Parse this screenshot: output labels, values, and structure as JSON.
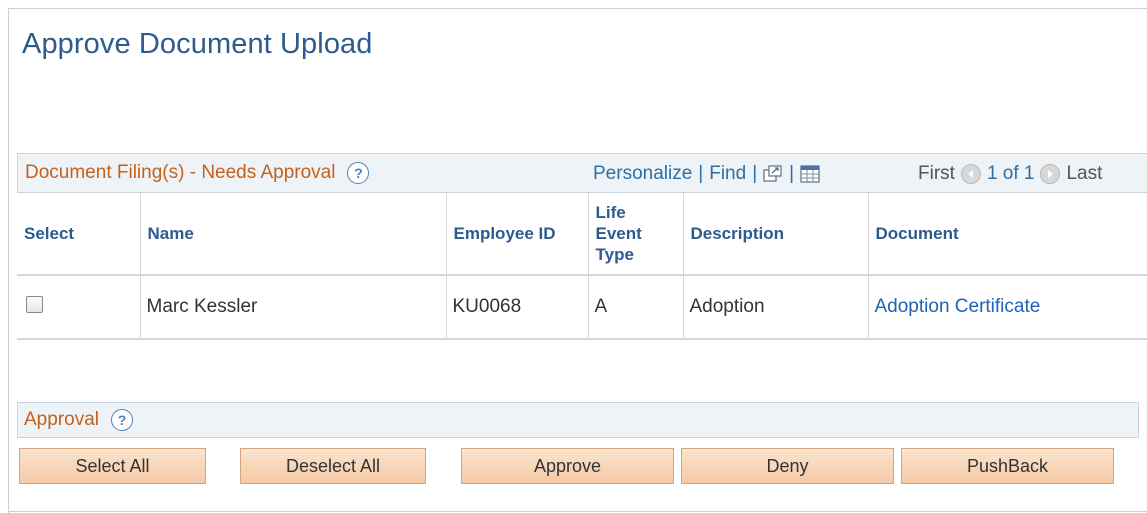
{
  "page": {
    "title": "Approve Document Upload"
  },
  "grid": {
    "title": "Document Filing(s) - Needs Approval",
    "help_icon": "?",
    "tools": {
      "personalize": "Personalize",
      "separator": "|",
      "find": "Find"
    },
    "nav": {
      "first": "First",
      "count": "1 of 1",
      "last": "Last"
    },
    "columns": {
      "select": "Select",
      "name": "Name",
      "employee_id": "Employee ID",
      "life_event_line1": "Life",
      "life_event_line2": "Event",
      "life_event_line3": "Type",
      "description": "Description",
      "document": "Document"
    },
    "rows": [
      {
        "selected": false,
        "name": "Marc Kessler",
        "employee_id": "KU0068",
        "life_event_type": "A",
        "description": "Adoption",
        "document": "Adoption Certificate"
      }
    ]
  },
  "approval": {
    "title": "Approval",
    "help_icon": "?",
    "buttons": {
      "select_all": "Select All",
      "deselect_all": "Deselect All",
      "approve": "Approve",
      "deny": "Deny",
      "pushback": "PushBack"
    }
  },
  "icons": {
    "view_all": "new-window-icon",
    "download": "spreadsheet-icon",
    "nav_prev": "arrow-left-icon",
    "nav_next": "arrow-right-icon"
  },
  "colors": {
    "title_blue": "#2d5b8d",
    "section_orange": "#c6601a",
    "link_blue": "#1f64b4",
    "button_peach": "#f5c9a4"
  }
}
